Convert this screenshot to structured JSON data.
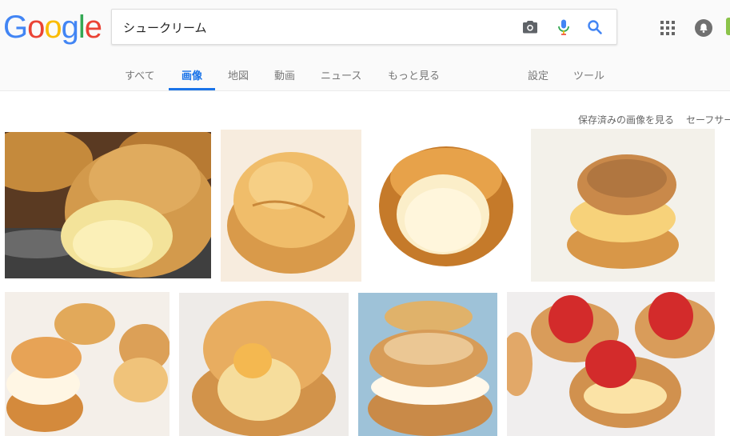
{
  "logo": {
    "text": "Google",
    "letters": [
      "G",
      "o",
      "o",
      "g",
      "l",
      "e"
    ],
    "colors": [
      "#4285F4",
      "#EA4335",
      "#FBBC05",
      "#4285F4",
      "#34A853",
      "#EA4335"
    ]
  },
  "search": {
    "query": "シュークリーム"
  },
  "tabs": [
    {
      "label": "すべて",
      "active": false
    },
    {
      "label": "画像",
      "active": true
    },
    {
      "label": "地図",
      "active": false
    },
    {
      "label": "動画",
      "active": false
    },
    {
      "label": "ニュース",
      "active": false
    },
    {
      "label": "もっと見る",
      "active": false
    }
  ],
  "tools": {
    "settings": "設定",
    "tools": "ツール"
  },
  "subbar": {
    "saved_images": "保存済みの画像を見る",
    "safesearch": "セーフサーチ"
  },
  "icons": {
    "camera": "camera-icon",
    "mic": "microphone-icon",
    "search": "search-icon",
    "apps": "apps-grid-icon",
    "notifications": "notifications-icon"
  },
  "colors": {
    "accent": "#1a73e8"
  }
}
